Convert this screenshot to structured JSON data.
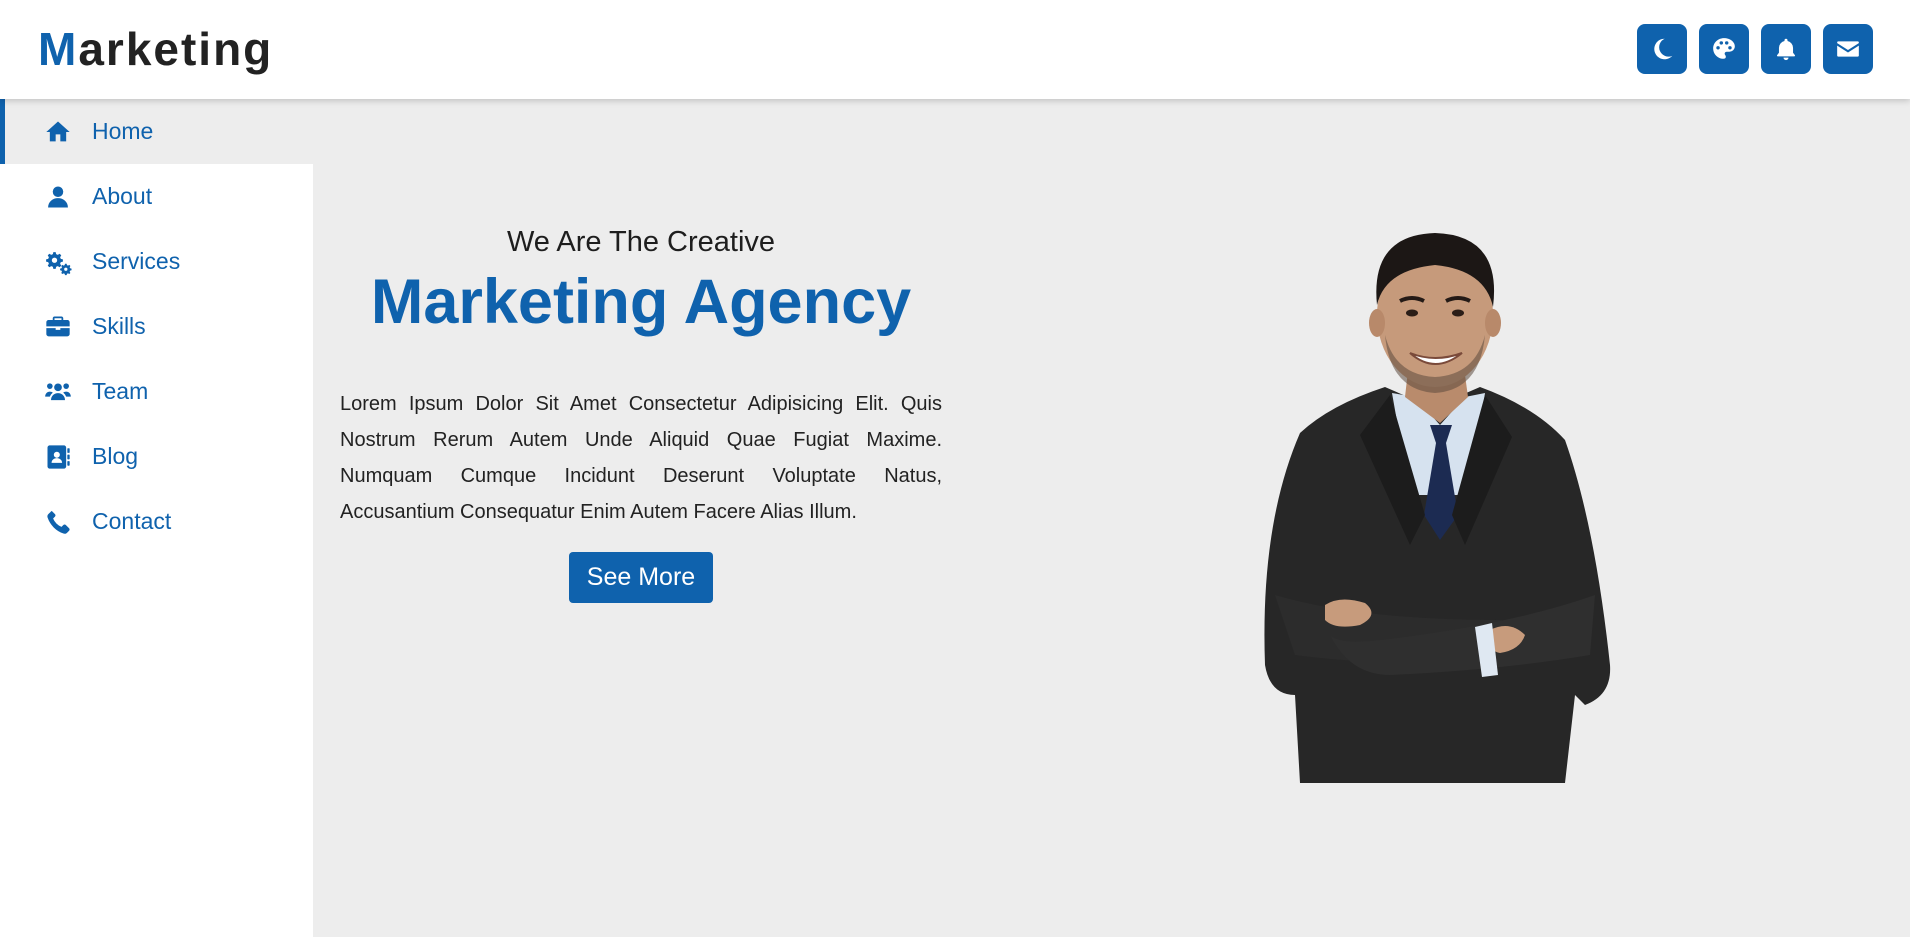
{
  "header": {
    "logo_first": "M",
    "logo_rest": "arketing",
    "actions": [
      {
        "icon": "moon-icon"
      },
      {
        "icon": "palette-icon"
      },
      {
        "icon": "bell-icon"
      },
      {
        "icon": "envelope-icon"
      }
    ]
  },
  "sidebar": {
    "items": [
      {
        "label": "Home",
        "icon": "home-icon",
        "active": true
      },
      {
        "label": "About",
        "icon": "user-icon"
      },
      {
        "label": "Services",
        "icon": "gears-icon"
      },
      {
        "label": "Skills",
        "icon": "briefcase-icon"
      },
      {
        "label": "Team",
        "icon": "users-icon"
      },
      {
        "label": "Blog",
        "icon": "address-book-icon"
      },
      {
        "label": "Contact",
        "icon": "phone-icon"
      }
    ]
  },
  "hero": {
    "kicker": "We Are The Creative",
    "headline": "Marketing Agency",
    "description": "Lorem Ipsum Dolor Sit Amet Consectetur Adipisicing Elit. Quis Nostrum Rerum Autem Unde Aliquid Quae Fugiat Maxime. Numquam Cumque Incidunt Deserunt Voluptate Natus, Accusantium Consequatur Enim Autem Facere Alias Illum.",
    "button": "See More",
    "image": "businessman-photo"
  },
  "colors": {
    "accent": "#0f62ad",
    "background": "#ededed",
    "surface": "#ffffff",
    "text": "#222222"
  }
}
